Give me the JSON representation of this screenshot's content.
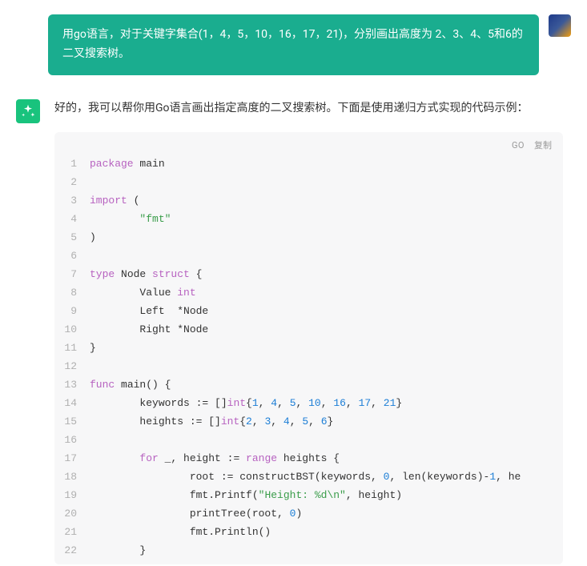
{
  "user_message": "用go语言，对于关键字集合(1，4，5，10，16，17，21)，分别画出高度为 2、3、4、5和6的二叉搜索树。",
  "assistant_intro": "好的，我可以帮你用Go语言画出指定高度的二叉搜索树。下面是使用递归方式实现的代码示例：",
  "code_lang": "GO",
  "copy_label": "复制",
  "code": {
    "lines": [
      [
        {
          "t": "kw",
          "v": "package"
        },
        {
          "t": "ident",
          "v": " main"
        }
      ],
      [],
      [
        {
          "t": "kw",
          "v": "import"
        },
        {
          "t": "ident",
          "v": " ("
        }
      ],
      [
        {
          "t": "ident",
          "v": "        "
        },
        {
          "t": "strgreen",
          "v": "\"fmt\""
        }
      ],
      [
        {
          "t": "ident",
          "v": ")"
        }
      ],
      [],
      [
        {
          "t": "kw",
          "v": "type"
        },
        {
          "t": "ident",
          "v": " Node "
        },
        {
          "t": "kw",
          "v": "struct"
        },
        {
          "t": "ident",
          "v": " {"
        }
      ],
      [
        {
          "t": "ident",
          "v": "        Value "
        },
        {
          "t": "typ",
          "v": "int"
        }
      ],
      [
        {
          "t": "ident",
          "v": "        Left  *Node"
        }
      ],
      [
        {
          "t": "ident",
          "v": "        Right *Node"
        }
      ],
      [
        {
          "t": "ident",
          "v": "}"
        }
      ],
      [],
      [
        {
          "t": "kw",
          "v": "func"
        },
        {
          "t": "ident",
          "v": " "
        },
        {
          "t": "fn",
          "v": "main"
        },
        {
          "t": "ident",
          "v": "() {"
        }
      ],
      [
        {
          "t": "ident",
          "v": "        keywords := []"
        },
        {
          "t": "typ",
          "v": "int"
        },
        {
          "t": "ident",
          "v": "{"
        },
        {
          "t": "num",
          "v": "1"
        },
        {
          "t": "ident",
          "v": ", "
        },
        {
          "t": "num",
          "v": "4"
        },
        {
          "t": "ident",
          "v": ", "
        },
        {
          "t": "num",
          "v": "5"
        },
        {
          "t": "ident",
          "v": ", "
        },
        {
          "t": "num",
          "v": "10"
        },
        {
          "t": "ident",
          "v": ", "
        },
        {
          "t": "num",
          "v": "16"
        },
        {
          "t": "ident",
          "v": ", "
        },
        {
          "t": "num",
          "v": "17"
        },
        {
          "t": "ident",
          "v": ", "
        },
        {
          "t": "num",
          "v": "21"
        },
        {
          "t": "ident",
          "v": "}"
        }
      ],
      [
        {
          "t": "ident",
          "v": "        heights := []"
        },
        {
          "t": "typ",
          "v": "int"
        },
        {
          "t": "ident",
          "v": "{"
        },
        {
          "t": "num",
          "v": "2"
        },
        {
          "t": "ident",
          "v": ", "
        },
        {
          "t": "num",
          "v": "3"
        },
        {
          "t": "ident",
          "v": ", "
        },
        {
          "t": "num",
          "v": "4"
        },
        {
          "t": "ident",
          "v": ", "
        },
        {
          "t": "num",
          "v": "5"
        },
        {
          "t": "ident",
          "v": ", "
        },
        {
          "t": "num",
          "v": "6"
        },
        {
          "t": "ident",
          "v": "}"
        }
      ],
      [],
      [
        {
          "t": "ident",
          "v": "        "
        },
        {
          "t": "kw",
          "v": "for"
        },
        {
          "t": "ident",
          "v": " _, height := "
        },
        {
          "t": "kw",
          "v": "range"
        },
        {
          "t": "ident",
          "v": " heights {"
        }
      ],
      [
        {
          "t": "ident",
          "v": "                root := constructBST(keywords, "
        },
        {
          "t": "num",
          "v": "0"
        },
        {
          "t": "ident",
          "v": ", "
        },
        {
          "t": "fn",
          "v": "len"
        },
        {
          "t": "ident",
          "v": "(keywords)-"
        },
        {
          "t": "num",
          "v": "1"
        },
        {
          "t": "ident",
          "v": ", he"
        }
      ],
      [
        {
          "t": "ident",
          "v": "                fmt.Printf("
        },
        {
          "t": "strgreen",
          "v": "\"Height: %d\\n\""
        },
        {
          "t": "ident",
          "v": ", height)"
        }
      ],
      [
        {
          "t": "ident",
          "v": "                printTree(root, "
        },
        {
          "t": "num",
          "v": "0"
        },
        {
          "t": "ident",
          "v": ")"
        }
      ],
      [
        {
          "t": "ident",
          "v": "                fmt.Println()"
        }
      ],
      [
        {
          "t": "ident",
          "v": "        }"
        }
      ]
    ]
  }
}
